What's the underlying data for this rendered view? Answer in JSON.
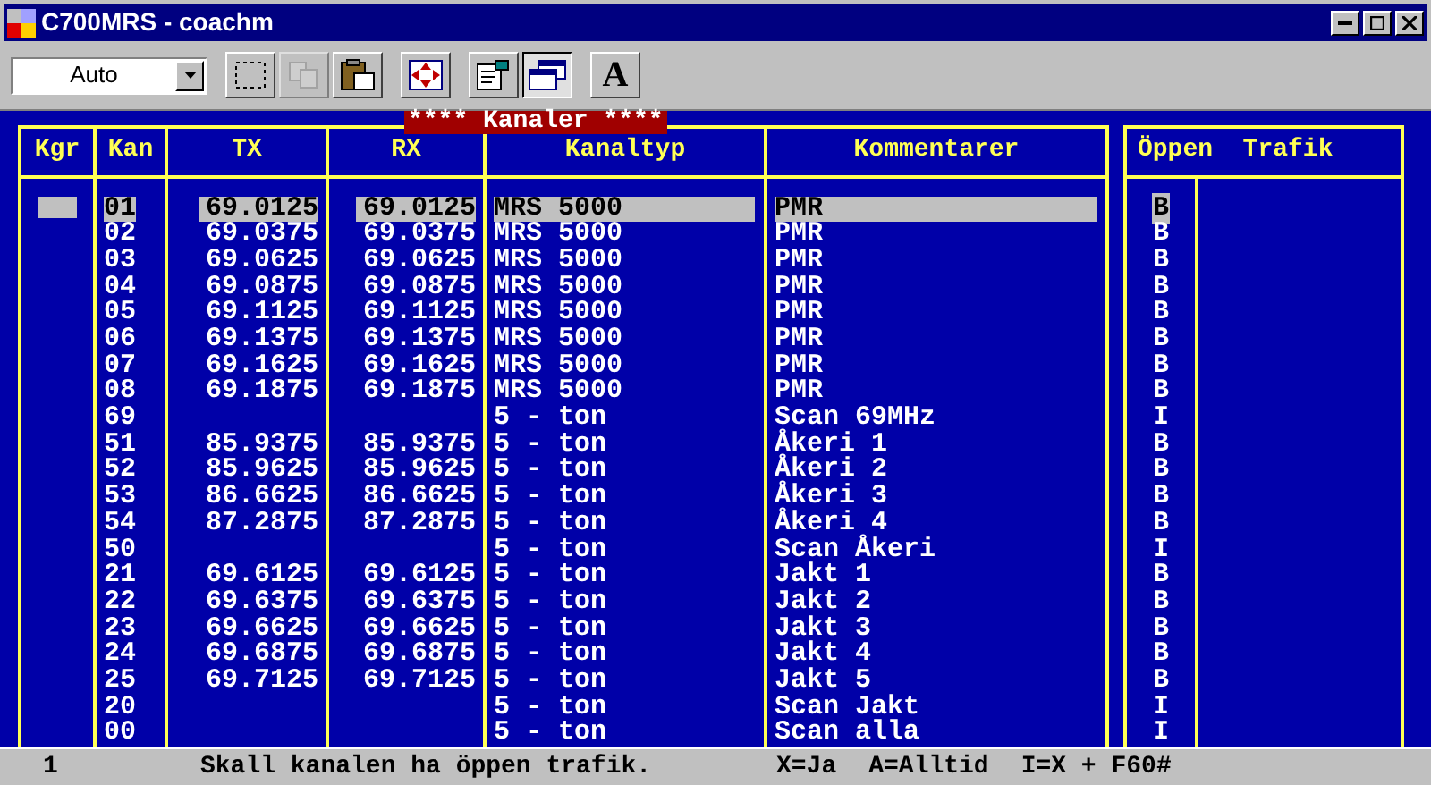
{
  "window": {
    "title": "C700MRS - coachm"
  },
  "toolbar": {
    "combo": {
      "value": "Auto"
    },
    "buttons": [
      {
        "kind": "select",
        "disabled": false,
        "pressed": false
      },
      {
        "kind": "copy",
        "disabled": true,
        "pressed": false
      },
      {
        "kind": "paste",
        "disabled": false,
        "pressed": false
      },
      {
        "kind": "move",
        "disabled": false,
        "pressed": false
      },
      {
        "kind": "properties",
        "disabled": false,
        "pressed": false
      },
      {
        "kind": "window",
        "disabled": false,
        "pressed": true
      },
      {
        "kind": "font",
        "label": "A",
        "disabled": false,
        "pressed": false
      }
    ]
  },
  "panel_title": "**** Kanaler ****",
  "table": {
    "columns": [
      "Kgr",
      "Kan",
      "TX",
      "RX",
      "Kanaltyp",
      "Kommentarer"
    ],
    "side_header": "Öppen  Trafik",
    "rows": [
      {
        "kan": "01",
        "tx": "69.0125",
        "rx": "69.0125",
        "type": "MRS 5000",
        "comment": "PMR",
        "open": "B",
        "selected": true
      },
      {
        "kan": "02",
        "tx": "69.0375",
        "rx": "69.0375",
        "type": "MRS 5000",
        "comment": "PMR",
        "open": "B",
        "selected": false
      },
      {
        "kan": "03",
        "tx": "69.0625",
        "rx": "69.0625",
        "type": "MRS 5000",
        "comment": "PMR",
        "open": "B",
        "selected": false
      },
      {
        "kan": "04",
        "tx": "69.0875",
        "rx": "69.0875",
        "type": "MRS 5000",
        "comment": "PMR",
        "open": "B",
        "selected": false
      },
      {
        "kan": "05",
        "tx": "69.1125",
        "rx": "69.1125",
        "type": "MRS 5000",
        "comment": "PMR",
        "open": "B",
        "selected": false
      },
      {
        "kan": "06",
        "tx": "69.1375",
        "rx": "69.1375",
        "type": "MRS 5000",
        "comment": "PMR",
        "open": "B",
        "selected": false
      },
      {
        "kan": "07",
        "tx": "69.1625",
        "rx": "69.1625",
        "type": "MRS 5000",
        "comment": "PMR",
        "open": "B",
        "selected": false
      },
      {
        "kan": "08",
        "tx": "69.1875",
        "rx": "69.1875",
        "type": "MRS 5000",
        "comment": "PMR",
        "open": "B",
        "selected": false
      },
      {
        "kan": "69",
        "type": "5 - ton",
        "comment": "Scan 69MHz",
        "open": "I",
        "selected": false
      },
      {
        "kan": "51",
        "tx": "85.9375",
        "rx": "85.9375",
        "type": "5 - ton",
        "comment": "Åkeri 1",
        "open": "B",
        "selected": false
      },
      {
        "kan": "52",
        "tx": "85.9625",
        "rx": "85.9625",
        "type": "5 - ton",
        "comment": "Åkeri 2",
        "open": "B",
        "selected": false
      },
      {
        "kan": "53",
        "tx": "86.6625",
        "rx": "86.6625",
        "type": "5 - ton",
        "comment": "Åkeri 3",
        "open": "B",
        "selected": false
      },
      {
        "kan": "54",
        "tx": "87.2875",
        "rx": "87.2875",
        "type": "5 - ton",
        "comment": "Åkeri 4",
        "open": "B",
        "selected": false
      },
      {
        "kan": "50",
        "type": "5 - ton",
        "comment": "Scan Åkeri",
        "open": "I",
        "selected": false
      },
      {
        "kan": "21",
        "tx": "69.6125",
        "rx": "69.6125",
        "type": "5 - ton",
        "comment": "Jakt 1",
        "open": "B",
        "selected": false
      },
      {
        "kan": "22",
        "tx": "69.6375",
        "rx": "69.6375",
        "type": "5 - ton",
        "comment": "Jakt 2",
        "open": "B",
        "selected": false
      },
      {
        "kan": "23",
        "tx": "69.6625",
        "rx": "69.6625",
        "type": "5 - ton",
        "comment": "Jakt 3",
        "open": "B",
        "selected": false
      },
      {
        "kan": "24",
        "tx": "69.6875",
        "rx": "69.6875",
        "type": "5 - ton",
        "comment": "Jakt 4",
        "open": "B",
        "selected": false
      },
      {
        "kan": "25",
        "tx": "69.7125",
        "rx": "69.7125",
        "type": "5 - ton",
        "comment": "Jakt 5",
        "open": "B",
        "selected": false
      },
      {
        "kan": "20",
        "type": "5 - ton",
        "comment": "Scan Jakt",
        "open": "I",
        "selected": false
      },
      {
        "kan": "00",
        "type": "5 - ton",
        "comment": "Scan alla",
        "open": "I",
        "selected": false
      }
    ]
  },
  "status_bar": {
    "line": "1",
    "message": "Skall kanalen ha öppen trafik.",
    "hints": [
      "X=Ja",
      "A=Alltid",
      "I=X + F60#"
    ]
  }
}
